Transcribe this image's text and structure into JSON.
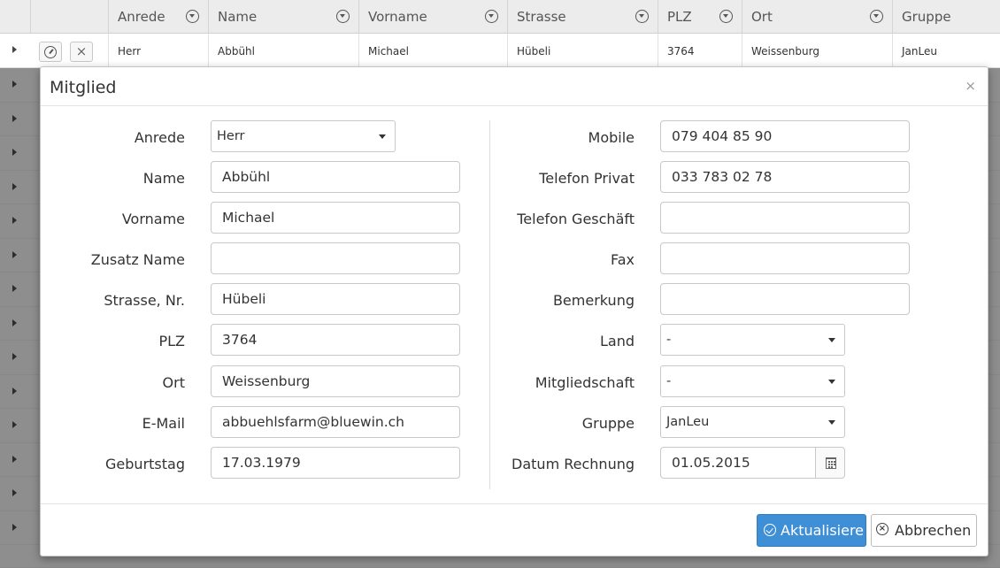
{
  "grid": {
    "columns": [
      {
        "label": "",
        "filter": false
      },
      {
        "label": "",
        "filter": false
      },
      {
        "label": "Anrede",
        "filter": true
      },
      {
        "label": "Name",
        "filter": true
      },
      {
        "label": "Vorname",
        "filter": true
      },
      {
        "label": "Strasse",
        "filter": true
      },
      {
        "label": "PLZ",
        "filter": true
      },
      {
        "label": "Ort",
        "filter": true
      },
      {
        "label": "Gruppe",
        "filter": false
      }
    ],
    "first_row": {
      "anrede": "Herr",
      "name": "Abbühl",
      "vorname": "Michael",
      "strasse": "Hübeli",
      "plz": "3764",
      "ort": "Weissenburg",
      "gruppe": "JanLeu"
    },
    "delete_glyph": "×"
  },
  "modal": {
    "title": "Mitglied",
    "close_glyph": "×",
    "left_fields": {
      "anrede": {
        "label": "Anrede",
        "value": "Herr"
      },
      "name": {
        "label": "Name",
        "value": "Abbühl"
      },
      "vorname": {
        "label": "Vorname",
        "value": "Michael"
      },
      "zusatz": {
        "label": "Zusatz Name",
        "value": ""
      },
      "strasse": {
        "label": "Strasse, Nr.",
        "value": "Hübeli"
      },
      "plz": {
        "label": "PLZ",
        "value": "3764"
      },
      "ort": {
        "label": "Ort",
        "value": "Weissenburg"
      },
      "email": {
        "label": "E-Mail",
        "value": "abbuehlsfarm@bluewin.ch"
      },
      "geburtstag": {
        "label": "Geburtstag",
        "value": "17.03.1979"
      }
    },
    "right_fields": {
      "mobile": {
        "label": "Mobile",
        "value": "079 404 85 90"
      },
      "telefon_privat": {
        "label": "Telefon Privat",
        "value": "033 783 02 78"
      },
      "telefon_geschaeft": {
        "label": "Telefon Geschäft",
        "value": ""
      },
      "fax": {
        "label": "Fax",
        "value": ""
      },
      "bemerkung": {
        "label": "Bemerkung",
        "value": ""
      },
      "land": {
        "label": "Land",
        "value": "-"
      },
      "mitgliedschaft": {
        "label": "Mitgliedschaft",
        "value": "-"
      },
      "gruppe": {
        "label": "Gruppe",
        "value": "JanLeu"
      },
      "datum_rechnung": {
        "label": "Datum Rechnung",
        "value": "01.05.2015"
      }
    },
    "buttons": {
      "update": "Aktualisiere",
      "cancel": "Abbrechen",
      "cancel_glyph": "×"
    }
  },
  "colors": {
    "primary": "#3f8fd6",
    "header_bg": "#ececec",
    "overlay": "#8e8e8e"
  }
}
